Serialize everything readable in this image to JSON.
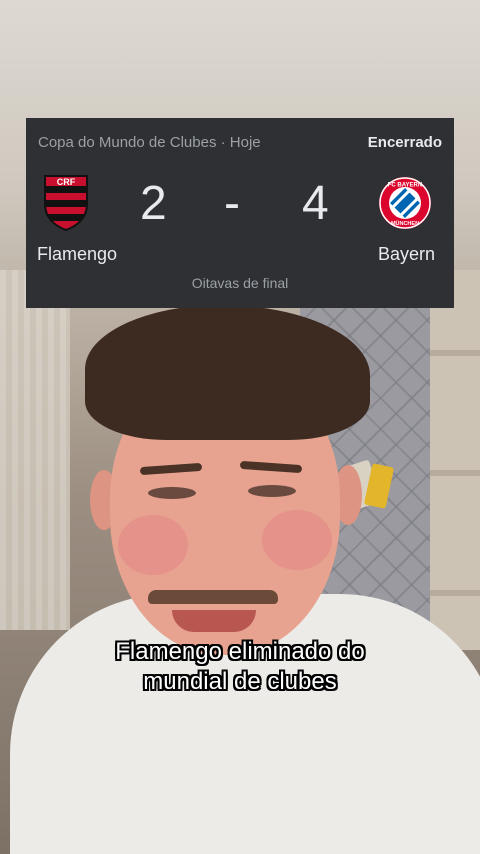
{
  "scoreboard": {
    "competition": "Copa do Mundo de Clubes · Hoje",
    "status": "Encerrado",
    "home": {
      "name": "Flamengo",
      "score": "2",
      "crest": "flamengo-crest-icon",
      "colors": [
        "#c8102e",
        "#111111"
      ]
    },
    "separator": "-",
    "away": {
      "name": "Bayern",
      "score": "4",
      "crest": "bayern-crest-icon",
      "crest_text": "FC BAYERN MÜNCHEN",
      "colors": [
        "#dc052d",
        "#0066b2"
      ]
    },
    "stage": "Oitavas de final"
  },
  "caption": {
    "line1": "Flamengo eliminado do",
    "line2": "mundial de clubes"
  }
}
